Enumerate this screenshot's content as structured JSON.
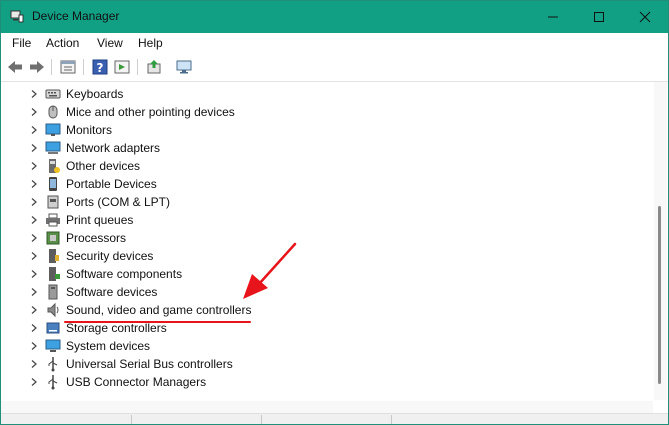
{
  "window": {
    "title": "Device Manager"
  },
  "window_controls": {
    "minimize": "minimize",
    "maximize": "maximize",
    "close": "close"
  },
  "menu": [
    "File",
    "Action",
    "View",
    "Help"
  ],
  "toolbar": [
    "back-icon",
    "forward-icon",
    "properties-icon",
    "help-icon",
    "show-hide-icon",
    "update-driver-icon",
    "scan-hardware-icon"
  ],
  "devices": [
    {
      "label": "Keyboards",
      "icon": "keyboard-icon"
    },
    {
      "label": "Mice and other pointing devices",
      "icon": "mouse-icon"
    },
    {
      "label": "Monitors",
      "icon": "monitor-icon"
    },
    {
      "label": "Network adapters",
      "icon": "network-adapter-icon"
    },
    {
      "label": "Other devices",
      "icon": "other-devices-icon"
    },
    {
      "label": "Portable Devices",
      "icon": "portable-device-icon"
    },
    {
      "label": "Ports (COM & LPT)",
      "icon": "port-icon"
    },
    {
      "label": "Print queues",
      "icon": "printer-icon"
    },
    {
      "label": "Processors",
      "icon": "processor-icon"
    },
    {
      "label": "Security devices",
      "icon": "security-device-icon"
    },
    {
      "label": "Software components",
      "icon": "software-component-icon"
    },
    {
      "label": "Software devices",
      "icon": "software-device-icon"
    },
    {
      "label": "Sound, video and game controllers",
      "icon": "speaker-icon"
    },
    {
      "label": "Storage controllers",
      "icon": "storage-controller-icon"
    },
    {
      "label": "System devices",
      "icon": "system-devices-icon"
    },
    {
      "label": "Universal Serial Bus controllers",
      "icon": "usb-icon"
    },
    {
      "label": "USB Connector Managers",
      "icon": "usb-connector-icon"
    }
  ],
  "colors": {
    "titlebar": "#12a085",
    "annotation": "#e8141b"
  }
}
